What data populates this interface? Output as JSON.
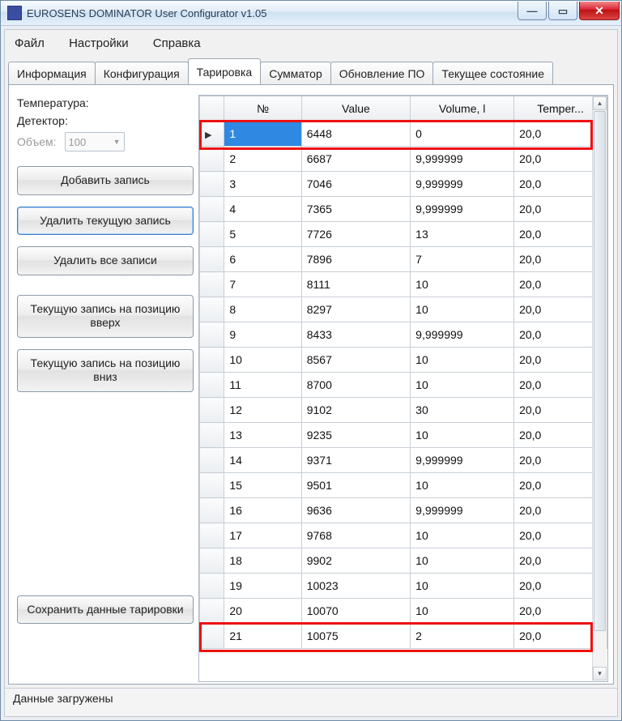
{
  "window": {
    "title": "EUROSENS DOMINATOR User Configurator v1.05"
  },
  "menu": {
    "file": "Файл",
    "settings": "Настройки",
    "help": "Справка"
  },
  "tabs": {
    "info": "Информация",
    "config": "Конфигурация",
    "calib": "Тарировка",
    "summ": "Сумматор",
    "update": "Обновление ПО",
    "state": "Текущее состояние"
  },
  "left": {
    "temperature": "Температура:",
    "detector": "Детектор:",
    "volume_label": "Объем:",
    "volume_value": "100",
    "btn_add": "Добавить запись",
    "btn_del_cur": "Удалить текущую запись",
    "btn_del_all": "Удалить все записи",
    "btn_move_up": "Текущую запись на позицию вверх",
    "btn_move_down": "Текущую запись на позицию вниз",
    "btn_save": "Сохранить данные тарировки"
  },
  "grid": {
    "headers": {
      "n": "№",
      "value": "Value",
      "volume": "Volume, l",
      "temper": "Temper..."
    },
    "rows": [
      {
        "n": "1",
        "value": "6448",
        "volume": "0",
        "temper": "20,0"
      },
      {
        "n": "2",
        "value": "6687",
        "volume": "9,999999",
        "temper": "20,0"
      },
      {
        "n": "3",
        "value": "7046",
        "volume": "9,999999",
        "temper": "20,0"
      },
      {
        "n": "4",
        "value": "7365",
        "volume": "9,999999",
        "temper": "20,0"
      },
      {
        "n": "5",
        "value": "7726",
        "volume": "13",
        "temper": "20,0"
      },
      {
        "n": "6",
        "value": "7896",
        "volume": "7",
        "temper": "20,0"
      },
      {
        "n": "7",
        "value": "8111",
        "volume": "10",
        "temper": "20,0"
      },
      {
        "n": "8",
        "value": "8297",
        "volume": "10",
        "temper": "20,0"
      },
      {
        "n": "9",
        "value": "8433",
        "volume": "9,999999",
        "temper": "20,0"
      },
      {
        "n": "10",
        "value": "8567",
        "volume": "10",
        "temper": "20,0"
      },
      {
        "n": "11",
        "value": "8700",
        "volume": "10",
        "temper": "20,0"
      },
      {
        "n": "12",
        "value": "9102",
        "volume": "30",
        "temper": "20,0"
      },
      {
        "n": "13",
        "value": "9235",
        "volume": "10",
        "temper": "20,0"
      },
      {
        "n": "14",
        "value": "9371",
        "volume": "9,999999",
        "temper": "20,0"
      },
      {
        "n": "15",
        "value": "9501",
        "volume": "10",
        "temper": "20,0"
      },
      {
        "n": "16",
        "value": "9636",
        "volume": "9,999999",
        "temper": "20,0"
      },
      {
        "n": "17",
        "value": "9768",
        "volume": "10",
        "temper": "20,0"
      },
      {
        "n": "18",
        "value": "9902",
        "volume": "10",
        "temper": "20,0"
      },
      {
        "n": "19",
        "value": "10023",
        "volume": "10",
        "temper": "20,0"
      },
      {
        "n": "20",
        "value": "10070",
        "volume": "10",
        "temper": "20,0"
      },
      {
        "n": "21",
        "value": "10075",
        "volume": "2",
        "temper": "20,0"
      }
    ],
    "selected_index": 0
  },
  "status": "Данные загружены"
}
